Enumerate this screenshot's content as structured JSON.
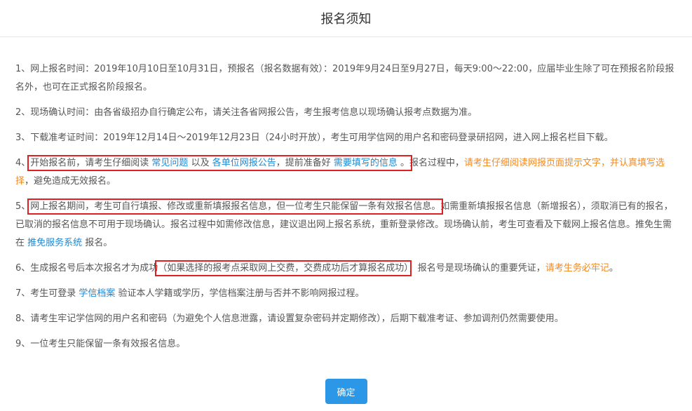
{
  "dialog": {
    "title": "报名须知",
    "confirm_label": "确定"
  },
  "items": {
    "i1": "1、网上报名时间：2019年10月10日至10月31日，预报名（报名数据有效）：2019年9月24日至9月27日，每天9:00～22:00，应届毕业生除了可在预报名阶段报名外，也可在正式报名阶段报名。",
    "i2": "2、现场确认时间：由各省级招办自行确定公布，请关注各省网报公告，考生报考信息以现场确认报考点数据为准。",
    "i3": "3、下载准考证时间：2019年12月14日～2019年12月23日（24小时开放），考生可用学信网的用户名和密码登录研招网，进入网上报名栏目下载。",
    "i4": {
      "num": "4、",
      "a": "开始报名前，请考生仔细阅读 ",
      "link1": "常见问题",
      "b": " 以及 ",
      "link2": "各单位网报公告",
      "c": "，提前准备好 ",
      "link3": "需要填写的信息",
      "d": " 。",
      "e": "报名过程中，",
      "warn": "请考生仔细阅读网报页面提示文字，并认真填写选择",
      "f": "，避免造成无效报名。"
    },
    "i5": {
      "num": "5、",
      "boxed": "网上报名期间，考生可自行填报、修改或重新填报报名信息，但一位考生只能保留一条有效报名信息。",
      "a": "如需重新填报报名信息（新增报名），须取消已有的报名，已取消的报名信息不可用于现场确认。报名过程中如需修改信息，建议退出网上报名系统，重新登录修改。现场确认前，考生可查看及下载网上报名信息。推免生需在 ",
      "link": "推免服务系统",
      "b": " 报名。"
    },
    "i6": {
      "a": "6、生成报名号后本次报名才为成功",
      "boxed": "（如果选择的报考点采取网上交费，交费成功后才算报名成功）",
      "b": "，报名号是现场确认的重要凭证，",
      "warn": "请考生务必牢记",
      "c": "。"
    },
    "i7": {
      "a": "7、考生可登录 ",
      "link": "学信档案",
      "b": " 验证本人学籍或学历，学信档案注册与否并不影响网报过程。"
    },
    "i8": "8、请考生牢记学信网的用户名和密码（为避免个人信息泄露，请设置复杂密码并定期修改），后期下载准考证、参加调剂仍然需要使用。",
    "i9": "9、一位考生只能保留一条有效报名信息。"
  },
  "colors": {
    "link": "#1e88d4",
    "warning": "#f08a24",
    "highlight_box": "#e02020",
    "button": "#2b97e6"
  }
}
